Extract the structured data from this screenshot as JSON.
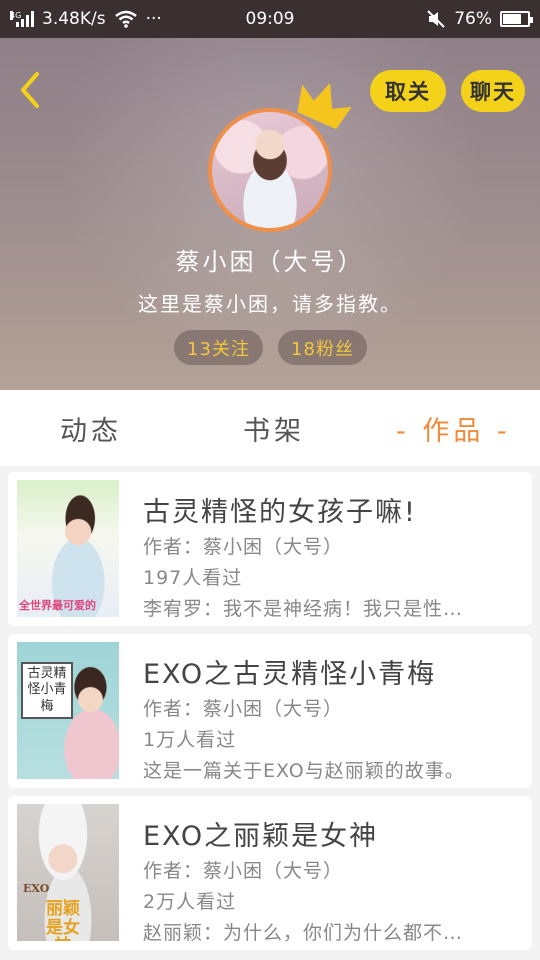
{
  "status_bar": {
    "network_type": "4G",
    "speed": "3.48K/s",
    "more": "···",
    "time": "09:09",
    "battery": "76%",
    "battery_level": 0.76
  },
  "profile": {
    "name": "蔡小困（大号）",
    "bio": "这里是蔡小困，请多指教。",
    "following": "13关注",
    "followers": "18粉丝",
    "unfollow_label": "取关",
    "chat_label": "聊天"
  },
  "tabs": [
    {
      "label": "动态"
    },
    {
      "label": "书架"
    },
    {
      "label": "- 作品 -",
      "active": true
    }
  ],
  "works": [
    {
      "title": "古灵精怪的女孩子嘛!",
      "author": "作者：蔡小困（大号）",
      "views": "197人看过",
      "desc": "李宥罗：我不是神经病！我只是性…",
      "cover_text": "全世界最可爱的"
    },
    {
      "title": "EXO之古灵精怪小青梅",
      "author": "作者：蔡小困（大号）",
      "views": "1万人看过",
      "desc": "这是一篇关于EXO与赵丽颖的故事。",
      "cover_text": "古灵精怪小青梅"
    },
    {
      "title": "EXO之丽颖是女神",
      "author": "作者：蔡小困（大号）",
      "views": "2万人看过",
      "desc": "赵丽颖：为什么，你们为什么都不…",
      "cover_text": "丽颖是女神",
      "cover_text_2": "EXO"
    }
  ],
  "colors": {
    "accent": "#f08a3c",
    "button_yellow": "#f5d21a",
    "stat_text": "#f3c73d",
    "avatar_border": "#ef8f4a"
  }
}
